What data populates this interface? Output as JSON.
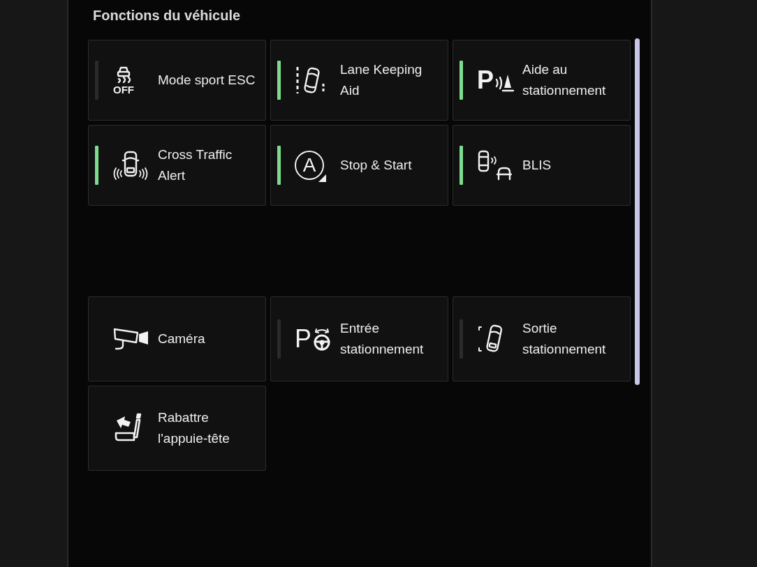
{
  "title": "Fonctions du véhicule",
  "groups": [
    {
      "tiles": [
        {
          "label": "Mode sport ESC",
          "kind": "toggle",
          "on": false,
          "icon_text": "OFF"
        },
        {
          "label": "Lane Keeping Aid",
          "kind": "toggle",
          "on": true
        },
        {
          "label": "Aide au stationnement",
          "kind": "toggle",
          "on": true,
          "icon_text": "P"
        },
        {
          "label": "Cross Traffic Alert",
          "kind": "toggle",
          "on": true
        },
        {
          "label": "Stop & Start",
          "kind": "toggle",
          "on": true,
          "icon_text": "A"
        },
        {
          "label": "BLIS",
          "kind": "toggle",
          "on": true
        }
      ]
    },
    {
      "tiles": [
        {
          "label": "Caméra",
          "kind": "action"
        },
        {
          "label": "Entrée stationnement",
          "kind": "toggle",
          "on": false,
          "icon_text": "P"
        },
        {
          "label": "Sortie stationnement",
          "kind": "toggle",
          "on": false
        },
        {
          "label": "Rabattre l'appuie-tête",
          "kind": "action"
        }
      ]
    }
  ]
}
